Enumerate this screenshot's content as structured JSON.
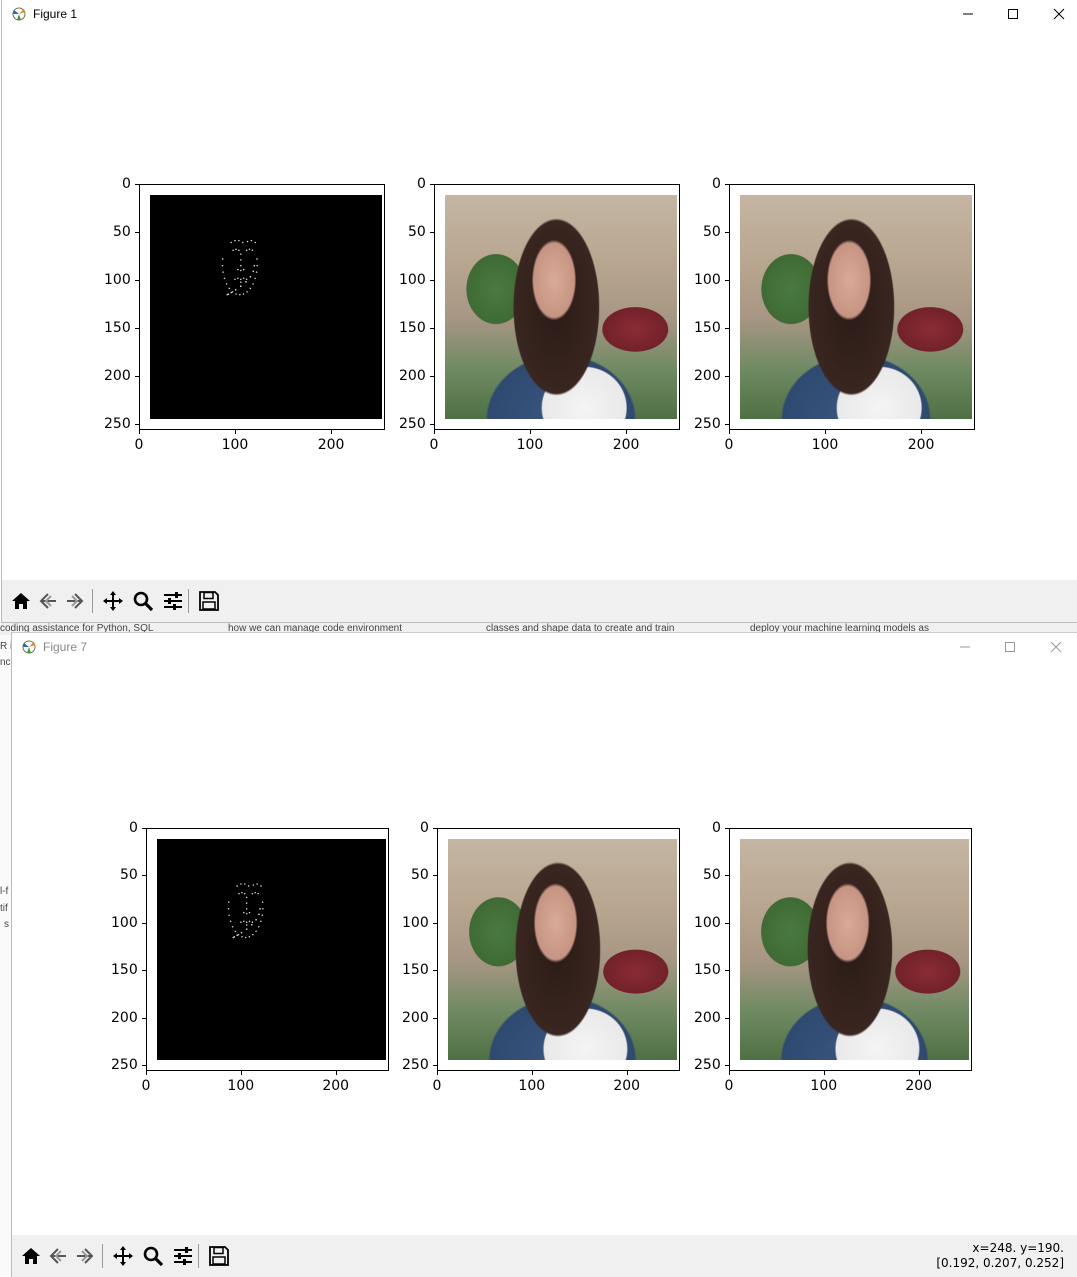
{
  "background": {
    "taskbar_tabs": [
      "coding assistance for Python, SQL",
      "how we can manage code environment",
      "classes and shape data to create and train",
      "deploy your machine learning models as"
    ],
    "side_fragments": [
      "y c",
      "R i",
      "nc",
      "l-f",
      "tif",
      "s"
    ]
  },
  "figure1": {
    "title": "Figure 1",
    "controls": {
      "minimize": "minimize-icon",
      "maximize": "maximize-icon",
      "close": "close-icon"
    },
    "subplots": [
      {
        "image": "black background with sparse white facial landmark dots",
        "x_ticks": [
          "0",
          "100",
          "200"
        ],
        "y_ticks": [
          "0",
          "50",
          "100",
          "150",
          "200",
          "250"
        ]
      },
      {
        "image": "woman with long brown hair and denim jacket, street background",
        "x_ticks": [
          "0",
          "100",
          "200"
        ],
        "y_ticks": [
          "0",
          "50",
          "100",
          "150",
          "200",
          "250"
        ]
      },
      {
        "image": "woman with long brown hair and denim jacket, street background",
        "x_ticks": [
          "0",
          "100",
          "200"
        ],
        "y_ticks": [
          "0",
          "50",
          "100",
          "150",
          "200",
          "250"
        ]
      }
    ],
    "toolbar": [
      "home-icon",
      "back-icon",
      "forward-icon",
      "pan-icon",
      "zoom-icon",
      "configure-subplots-icon",
      "save-icon"
    ]
  },
  "figure7": {
    "title": "Figure 7",
    "controls": {
      "minimize": "minimize-icon",
      "maximize": "maximize-icon",
      "close": "close-icon"
    },
    "subplots": [
      {
        "image": "black background with sparse white facial landmark dots",
        "x_ticks": [
          "0",
          "100",
          "200"
        ],
        "y_ticks": [
          "0",
          "50",
          "100",
          "150",
          "200",
          "250"
        ]
      },
      {
        "image": "woman with long brown hair and denim jacket, street background",
        "x_ticks": [
          "0",
          "100",
          "200"
        ],
        "y_ticks": [
          "0",
          "50",
          "100",
          "150",
          "200",
          "250"
        ]
      },
      {
        "image": "woman with long brown hair and denim jacket, street background",
        "x_ticks": [
          "0",
          "100",
          "200"
        ],
        "y_ticks": [
          "0",
          "50",
          "100",
          "150",
          "200",
          "250"
        ]
      }
    ],
    "toolbar": [
      "home-icon",
      "back-icon",
      "forward-icon",
      "pan-icon",
      "zoom-icon",
      "configure-subplots-icon",
      "save-icon"
    ],
    "status": {
      "position": "x=248. y=190.",
      "pixel_value": "[0.192, 0.207, 0.252]"
    }
  }
}
